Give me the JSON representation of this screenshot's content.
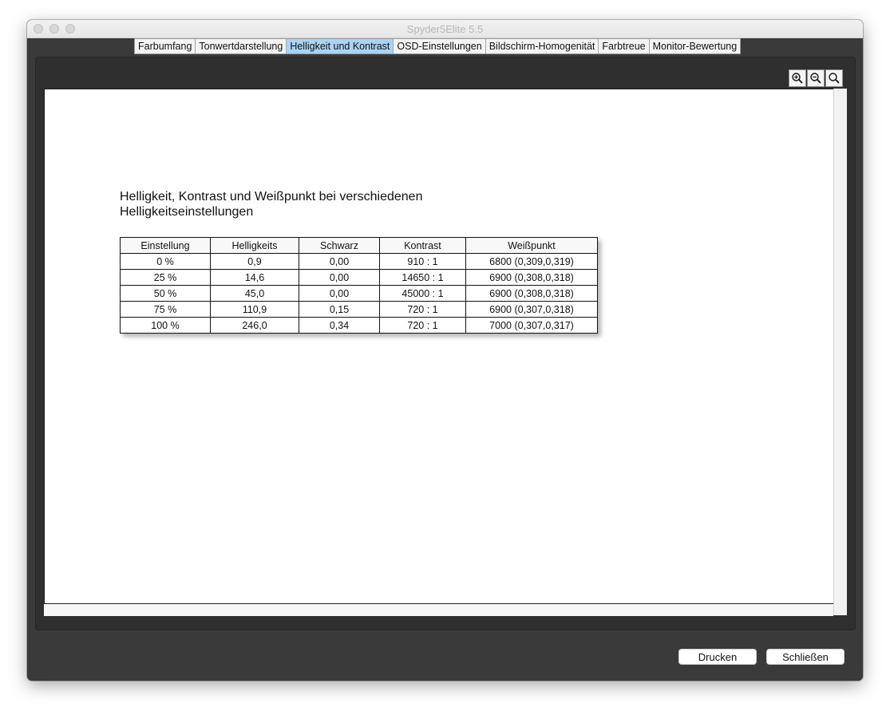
{
  "window": {
    "title": "Spyder5Elite 5.5"
  },
  "tabs": [
    {
      "label": "Farbumfang",
      "active": false
    },
    {
      "label": "Tonwertdarstellung",
      "active": false
    },
    {
      "label": "Helligkeit und Kontrast",
      "active": true
    },
    {
      "label": "OSD-Einstellungen",
      "active": false
    },
    {
      "label": "Bildschirm-Homogenität",
      "active": false
    },
    {
      "label": "Farbtreue",
      "active": false
    },
    {
      "label": "Monitor-Bewertung",
      "active": false
    }
  ],
  "zoom_tools": [
    {
      "icon": "zoom-in-icon"
    },
    {
      "icon": "zoom-out-icon"
    },
    {
      "icon": "zoom-fit-icon"
    }
  ],
  "report": {
    "title_line1": "Helligkeit, Kontrast und Weißpunkt bei verschiedenen",
    "title_line2": "Helligkeitseinstellungen",
    "table": {
      "headers": [
        "Einstellung",
        "Helligkeits",
        "Schwarz",
        "Kontrast",
        "Weißpunkt"
      ],
      "rows": [
        [
          "0 %",
          "0,9",
          "0,00",
          "910 : 1",
          "6800 (0,309,0,319)"
        ],
        [
          "25 %",
          "14,6",
          "0,00",
          "14650 : 1",
          "6900 (0,308,0,318)"
        ],
        [
          "50 %",
          "45,0",
          "0,00",
          "45000 : 1",
          "6900 (0,308,0,318)"
        ],
        [
          "75 %",
          "110,9",
          "0,15",
          "720 : 1",
          "6900 (0,307,0,318)"
        ],
        [
          "100 %",
          "246,0",
          "0,34",
          "720 : 1",
          "7000 (0,307,0,317)"
        ]
      ]
    }
  },
  "buttons": {
    "print_label": "Drucken",
    "close_label": "Schließen"
  },
  "colors": {
    "active_tab": "#a8d4f7",
    "window_bg": "#3a3a3a"
  }
}
